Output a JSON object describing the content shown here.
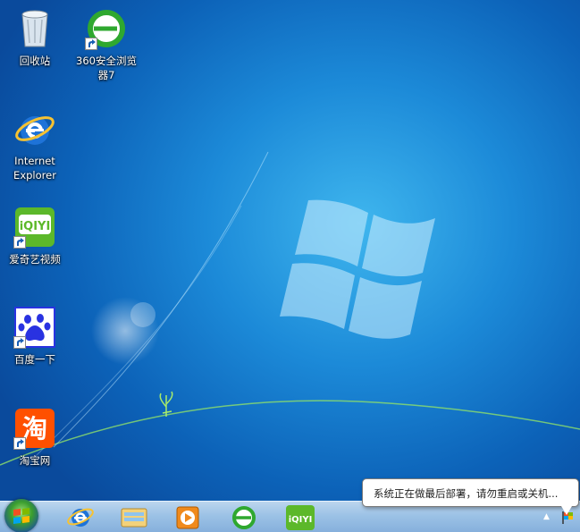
{
  "desktop": {
    "icons": [
      {
        "label": "回收站",
        "icon": "recycle-bin-icon",
        "shortcut": false
      },
      {
        "label": "360安全浏览\n器7",
        "icon": "360-browser-icon",
        "shortcut": true
      },
      {
        "label": "Internet\nExplorer",
        "icon": "ie-icon",
        "shortcut": false
      },
      {
        "label": "爱奇艺视频",
        "icon": "iqiyi-icon",
        "shortcut": true
      },
      {
        "label": "百度一下",
        "icon": "baidu-paw-icon",
        "shortcut": true
      },
      {
        "label": "淘宝网",
        "icon": "taobao-icon",
        "shortcut": true
      }
    ]
  },
  "taskbar": {
    "start_icon": "windows-orb-icon",
    "pinned": [
      {
        "icon": "ie-icon"
      },
      {
        "icon": "explorer-folder-icon"
      },
      {
        "icon": "media-player-icon"
      },
      {
        "icon": "360-browser-icon"
      },
      {
        "icon": "iqiyi-icon"
      }
    ],
    "tray": {
      "show_hidden_glyph": "▲",
      "flag_icon": "action-center-flag-icon"
    }
  },
  "notification": {
    "message": "系统正在做最后部署，请勿重启或关机..."
  },
  "colors": {
    "accent": "#1c8ad8",
    "iqiyi_green": "#5cb82a",
    "baidu_blue": "#2932e1",
    "taobao_orange": "#ff5000",
    "browser360_green": "#2fa82f"
  }
}
